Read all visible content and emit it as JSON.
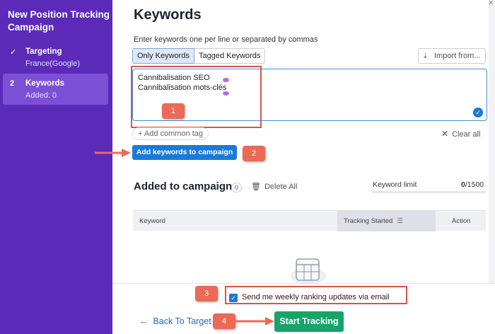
{
  "sidebar": {
    "title": "New Position Tracking Campaign",
    "steps": [
      {
        "marker": "✓",
        "name": "Targeting",
        "sub": "France(Google)"
      },
      {
        "marker": "2",
        "name": "Keywords",
        "sub": "Added: 0"
      }
    ]
  },
  "main": {
    "title": "Keywords",
    "info_icon": "info-icon",
    "hint": "Enter keywords one per line or separated by commas",
    "tabs": [
      {
        "label": "Only Keywords"
      },
      {
        "label": "Tagged Keywords"
      }
    ],
    "import_label": "Import from...",
    "keywords": [
      "Cannibalisation SEO",
      "Cannibalisation mots-clés"
    ],
    "add_common_tag": "+ Add common tag",
    "clear_all": "Clear all",
    "add_button": "Add keywords to campaign",
    "added_title": "Added to campaign",
    "added_count": "0",
    "delete_all": "Delete All",
    "keyword_limit_label": "Keyword limit",
    "keyword_limit_used": "0",
    "keyword_limit_total": "/1500",
    "table_headers": {
      "keyword": "Keyword",
      "tracking": "Tracking Started",
      "action": "Action"
    }
  },
  "footer": {
    "email_label": "Send me weekly ranking updates via email",
    "email_checked": true,
    "back_label": "Back To Target",
    "start_label": "Start Tracking"
  },
  "annotations": [
    "1",
    "2",
    "3",
    "4"
  ],
  "colors": {
    "sidebar_bg": "#5b2ab8",
    "sidebar_active": "#7d4fd6",
    "primary_blue": "#1a7ad8",
    "start_green": "#17a36a",
    "annotation_red": "#ec6a55"
  }
}
